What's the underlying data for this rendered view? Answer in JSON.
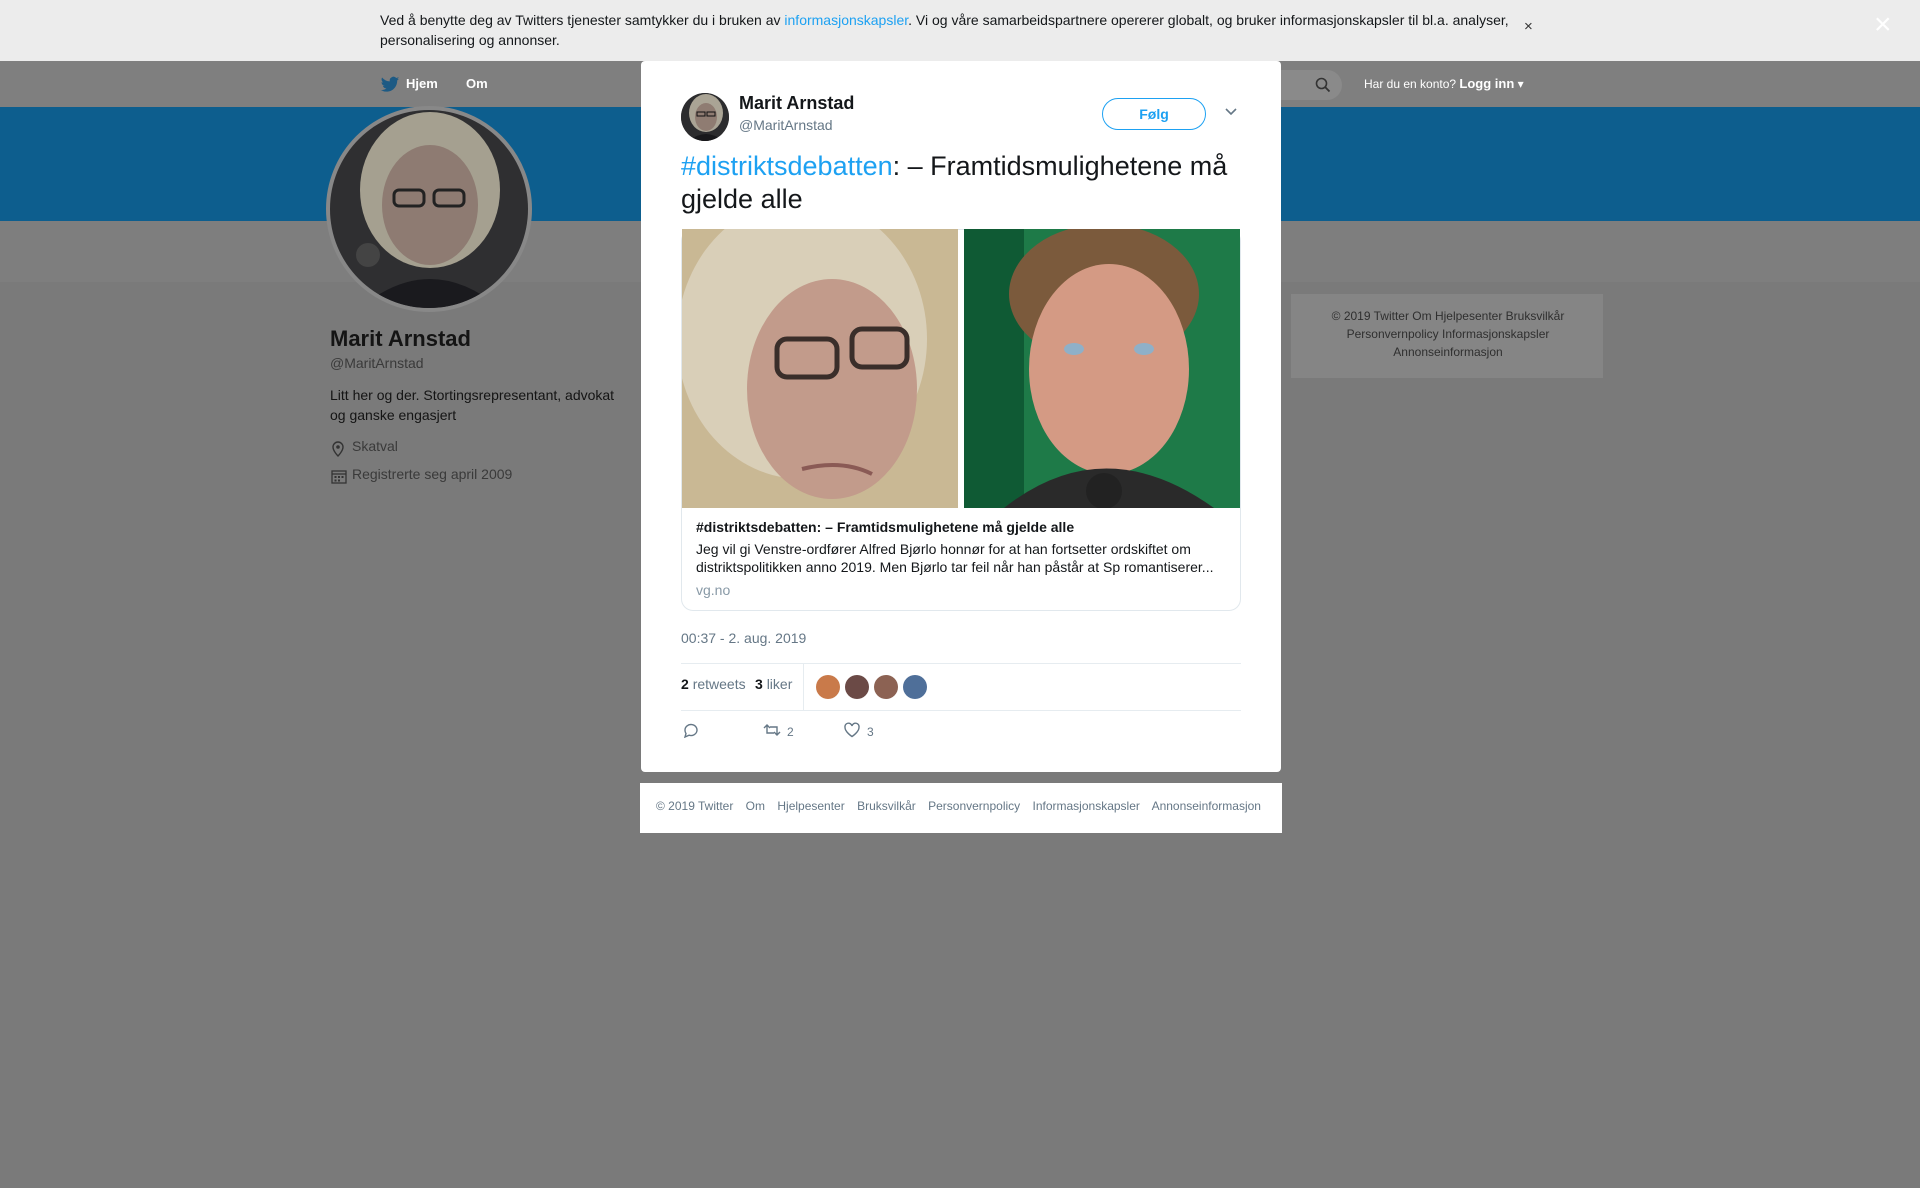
{
  "cookie_banner": {
    "text_before": "Ved å benytte deg av Twitters tjenester samtykker du i bruken av ",
    "link": "informasjonskapsler",
    "text_after": ". Vi og våre samarbeidspartnere opererer globalt, og bruker informasjonskapsler til bl.a. analyser, personalisering og annonser.",
    "close": "×"
  },
  "overlay_close": "×",
  "nav": {
    "home": "Hjem",
    "about": "Om",
    "has_account": "Har du en konto?",
    "login": "Logg inn"
  },
  "profile": {
    "name": "Marit Arnstad",
    "handle": "@MaritArnstad",
    "bio": "Litt her og der. Stortingsrepresentant, advokat og ganske engasjert",
    "location": "Skatval",
    "joined": "Registrerte seg april 2009"
  },
  "side_footer": "© 2019 Twitter   Om   Hjelpesenter   Bruksvilkår   Personvernpolicy   Informasjonskapsler   Annonseinformasjon",
  "tweet": {
    "author_name": "Marit Arnstad",
    "author_handle": "@MaritArnstad",
    "follow": "Følg",
    "hashtag": "#distriktsdebatten",
    "text": ": – Framtidsmulighetene må gjelde alle",
    "card": {
      "title": "#distriktsdebatten: – Framtidsmulighetene må gjelde alle",
      "description": "Jeg vil gi Venstre-ordfører Alfred Bjørlo honnør for at han fortsetter ordskiftet om distriktspolitikken anno 2019. Men Bjørlo tar feil når han påstår at Sp romantiserer...",
      "domain": "vg.no"
    },
    "timestamp": "00:37 - 2. aug. 2019",
    "retweets_count": "2",
    "retweets_label": "retweets",
    "likes_count": "3",
    "likes_label": "liker",
    "action_retweets": "2",
    "action_likes": "3"
  },
  "modal_footer": [
    "© 2019 Twitter",
    "Om",
    "Hjelpesenter",
    "Bruksvilkår",
    "Personvernpolicy",
    "Informasjonskapsler",
    "Annonseinformasjon"
  ],
  "colors": {
    "accent": "#1da1f2",
    "text": "#14171a",
    "muted": "#657786",
    "overlay": "#7a7a7a"
  }
}
